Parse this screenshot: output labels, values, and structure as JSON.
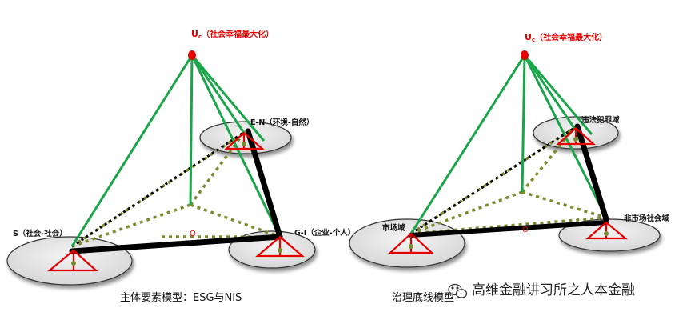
{
  "left_diagram": {
    "apex_label": "U",
    "apex_sub": "c",
    "apex_text": "（社会幸福最大化）",
    "node_en_label": "E-N（环境-自然）",
    "node_s_label": "S（社会-社会）",
    "node_gi_label": "G-I（企业-个人）",
    "center_label": "O",
    "caption": "主体要素模型：ESG与NIS"
  },
  "right_diagram": {
    "apex_label": "U",
    "apex_sub": "c",
    "apex_text": "（社会幸福最大化）",
    "node_top_label": "违法犯罪域",
    "node_left_label": "市场域",
    "node_right_label": "非市场社会域",
    "center_label": "O",
    "caption": "治理底线模型"
  },
  "watermark": {
    "icon": "wechat-icon",
    "text": "高维金融讲习所之人本金融"
  },
  "colors": {
    "green": "#1aa54a",
    "olive": "#7a8a2e",
    "red": "#e60000",
    "black": "#000000",
    "disk_fill": "#e6e6e6"
  }
}
